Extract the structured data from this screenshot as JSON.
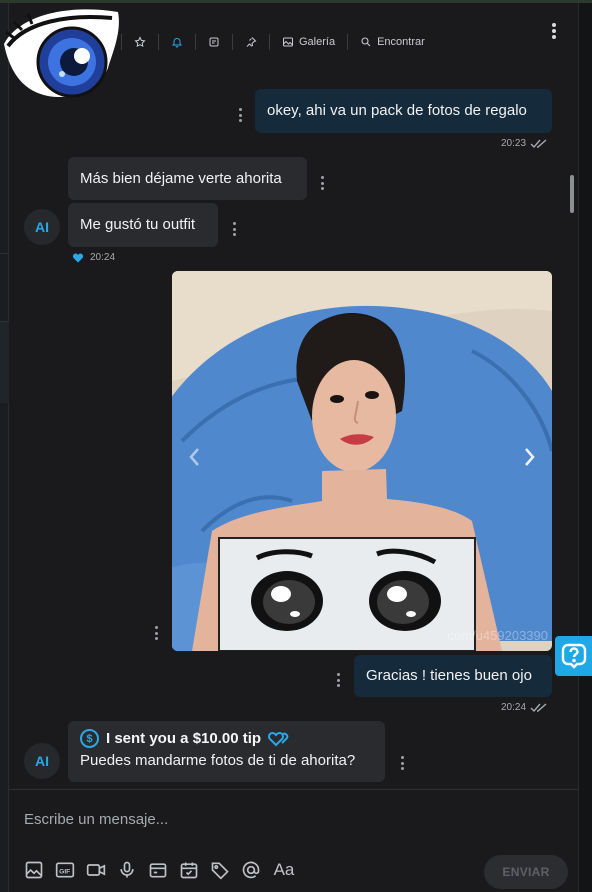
{
  "toolbar": {
    "items": [
      {
        "icon": "star-icon",
        "label": ""
      },
      {
        "icon": "bell-icon",
        "label": ""
      },
      {
        "icon": "note-icon",
        "label": ""
      },
      {
        "icon": "pin-icon",
        "label": ""
      },
      {
        "icon": "gallery-icon",
        "label": "Galería"
      },
      {
        "icon": "search-icon",
        "label": "Encontrar"
      }
    ]
  },
  "messages": {
    "m1": {
      "text": "okey, ahi va un pack de fotos de regalo",
      "time": "20:23"
    },
    "m2": {
      "text": "Más bien déjame verte ahorita"
    },
    "m3": {
      "text": "Me gustó tu outfit",
      "time": "20:24"
    },
    "photo": {
      "watermark": "com/u459203390"
    },
    "m4": {
      "text": "Gracias ! tienes buen ojo",
      "time": "20:24"
    },
    "tip": {
      "title": "I sent you a $10.00 tip",
      "text": "Puedes mandarme fotos de ti de ahorita?"
    }
  },
  "avatar": {
    "initials": "AI"
  },
  "composer": {
    "placeholder": "Escribe un mensaje...",
    "send_label": "ENVIAR"
  },
  "colors": {
    "accent": "#2aa7e8",
    "outgoing_bubble": "#152a3a",
    "incoming_bubble": "#2a2b2e",
    "background": "#1a1a1c"
  }
}
